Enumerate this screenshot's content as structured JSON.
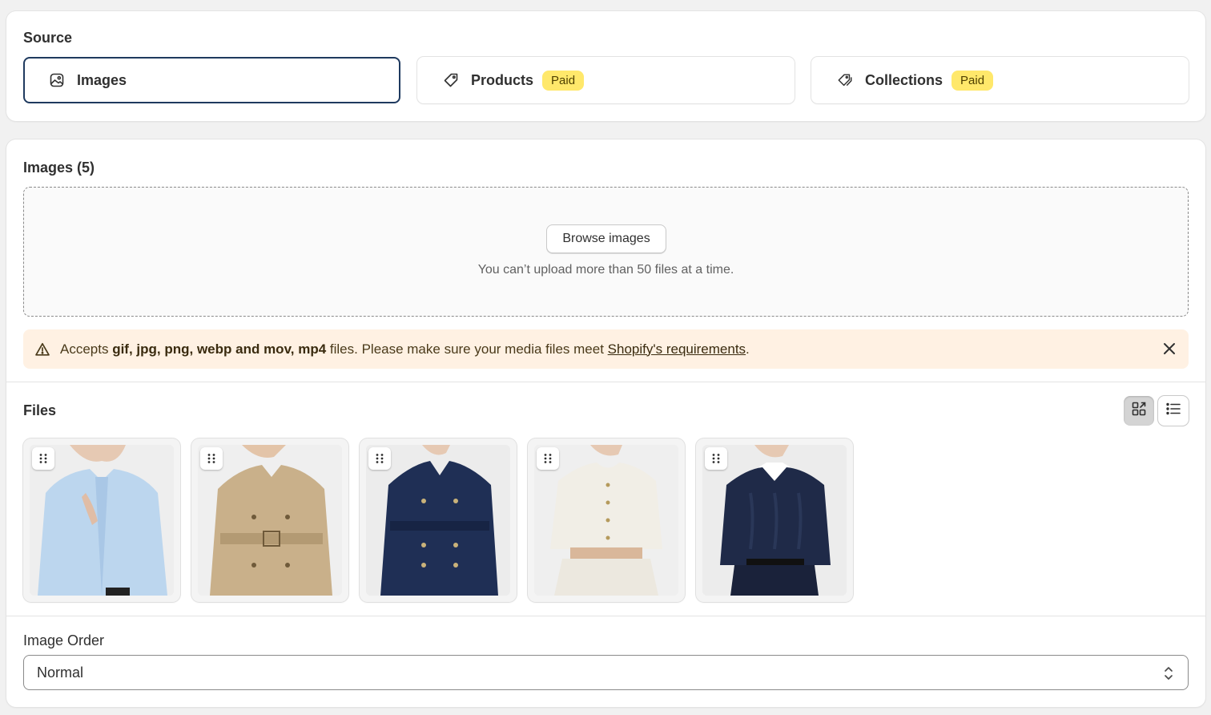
{
  "source": {
    "title": "Source",
    "options": [
      {
        "label": "Images",
        "selected": true,
        "icon": "image-icon"
      },
      {
        "label": "Products",
        "badge": "Paid",
        "icon": "tag-icon"
      },
      {
        "label": "Collections",
        "badge": "Paid",
        "icon": "collection-tag-icon"
      }
    ]
  },
  "images": {
    "title": "Images (5)",
    "browse_label": "Browse images",
    "upload_note": "You can’t upload more than 50 files at a time."
  },
  "banner": {
    "prefix": "Accepts ",
    "formats": "gif, jpg, png, webp and mov, mp4",
    "middle": " files. Please make sure your media files meet ",
    "link": "Shopify's requirements",
    "suffix": ".",
    "icon": "alert-triangle-icon",
    "close_icon": "close-icon"
  },
  "files": {
    "title": "Files",
    "view_modes": [
      "grid-view-icon",
      "list-view-icon"
    ],
    "active_view": "grid",
    "items": [
      {
        "garment": "light blue button-up shirt",
        "color": "#bcd6ee"
      },
      {
        "garment": "khaki belted trench coat",
        "color": "#c9b08a"
      },
      {
        "garment": "navy double-breasted coat",
        "color": "#1f2f55"
      },
      {
        "garment": "white cropped jacket",
        "color": "#efece4"
      },
      {
        "garment": "navy cable-knit sweater",
        "color": "#1f2a48"
      }
    ]
  },
  "order": {
    "label": "Image Order",
    "value": "Normal"
  },
  "colors": {
    "selected_border": "#1f3a5f",
    "badge_bg": "#ffe86b",
    "banner_bg": "#fff1e3"
  }
}
